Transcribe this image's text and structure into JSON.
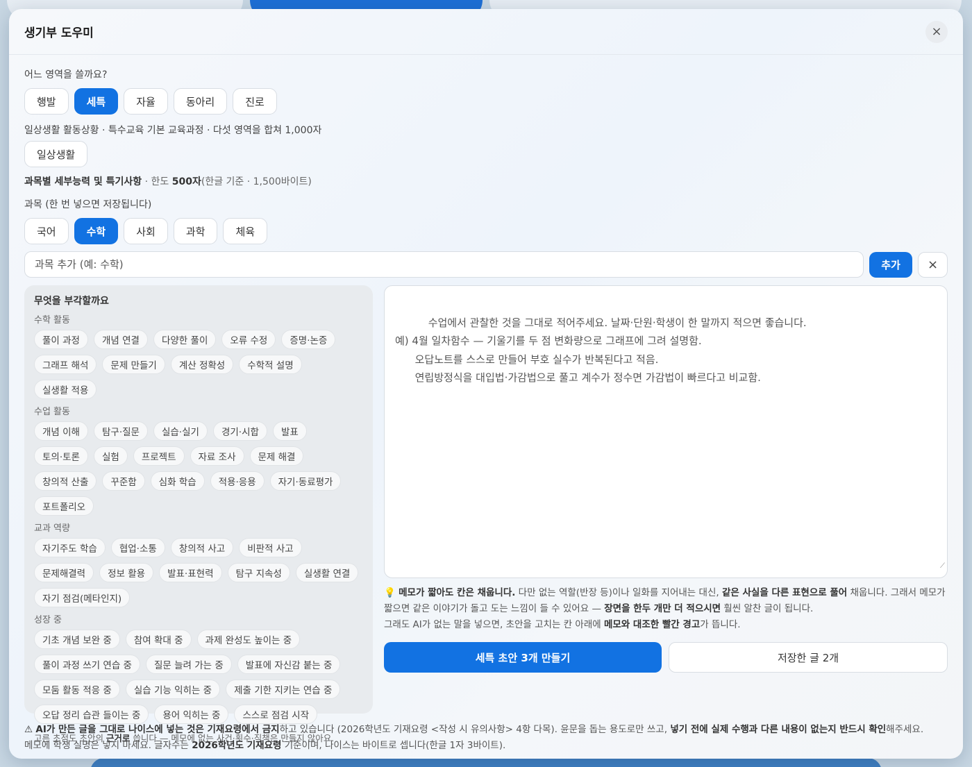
{
  "modal": {
    "title": "생기부 도우미",
    "close_icon": "×"
  },
  "area": {
    "label": "어느 영역을 쓸까요?",
    "tabs": [
      "행발",
      "세특",
      "자율",
      "동아리",
      "진로"
    ],
    "selected": "세특"
  },
  "daily": {
    "note": "일상생활 활동상황 · 특수교육 기본 교육과정 · 다섯 영역을 합쳐 1,000자",
    "button": "일상생활"
  },
  "limit": {
    "bold": "과목별 세부능력 및 특기사항",
    "middle": " · 한도 ",
    "bold2": "500자",
    "rest": "(한글 기준 · 1,500바이트)"
  },
  "subjects": {
    "label": "과목 (한 번 넣으면 저장됩니다)",
    "tabs": [
      "국어",
      "수학",
      "사회",
      "과학",
      "체육"
    ],
    "selected": "수학",
    "input_placeholder": "과목 추가 (예: 수학)",
    "add_label": "추가",
    "clear_icon": "×"
  },
  "panel": {
    "title": "무엇을 부각할까요",
    "groups": [
      {
        "label": "수학 활동",
        "chips": [
          "풀이 과정",
          "개념 연결",
          "다양한 풀이",
          "오류 수정",
          "증명·논증",
          "그래프 해석",
          "문제 만들기",
          "계산 정확성",
          "수학적 설명",
          "실생활 적용"
        ]
      },
      {
        "label": "수업 활동",
        "chips": [
          "개념 이해",
          "탐구·질문",
          "실습·실기",
          "경기·시합",
          "발표",
          "토의·토론",
          "실험",
          "프로젝트",
          "자료 조사",
          "문제 해결",
          "창의적 산출",
          "꾸준함",
          "심화 학습",
          "적용·응용",
          "자기·동료평가",
          "포트폴리오"
        ]
      },
      {
        "label": "교과 역량",
        "chips": [
          "자기주도 학습",
          "협업·소통",
          "창의적 사고",
          "비판적 사고",
          "문제해결력",
          "정보 활용",
          "발표·표현력",
          "탐구 지속성",
          "실생활 연결",
          "자기 점검(메타인지)"
        ]
      },
      {
        "label": "성장 중",
        "chips": [
          "기초 개념 보완 중",
          "참여 확대 중",
          "과제 완성도 높이는 중",
          "풀이 과정 쓰기 연습 중",
          "질문 늘려 가는 중",
          "발표에 자신감 붙는 중",
          "모둠 활동 적응 중",
          "실습 기능 익히는 중",
          "제출 기한 지키는 연습 중",
          "오답 정리 습관 들이는 중",
          "용어 익히는 중",
          "스스로 점검 시작"
        ]
      }
    ],
    "foot_pre": "고른 초점도 초안의 ",
    "foot_bold": "근거로",
    "foot_post": " 씁니다 — 메모에 없는 사건·횟수·직책은 만들지 않아요."
  },
  "memo": {
    "placeholder": "수업에서 관찰한 것을 그대로 적어주세요. 날짜·단원·학생이 한 말까지 적으면 좋습니다.\n예) 4월 일차함수 — 기울기를 두 점 변화량으로 그래프에 그려 설명함.\n      오답노트를 스스로 만들어 부호 실수가 반복된다고 적음.\n      연립방정식을 대입법·가감법으로 풀고 계수가 정수면 가감법이 빠르다고 비교함.",
    "resize_icon": "⟋"
  },
  "tip": {
    "icon": "💡",
    "b1": "메모가 짧아도 칸은 채웁니다.",
    "t1": " 다만 없는 역할(반장 등)이나 일화를 지어내는 대신, ",
    "b2": "같은 사실을 다른 표현으로 풀어",
    "t2": " 채웁니다. 그래서 메모가 짧으면 같은 이야기가 돌고 도는 느낌이 들 수 있어요 — ",
    "b3": "장면을 한두 개만 더 적으시면",
    "t3": " 훨씬 알찬 글이 됩니다.",
    "t4": "그래도 AI가 없는 말을 넣으면, 초안을 고치는 칸 아래에 ",
    "b4": "메모와 대조한 빨간 경고",
    "t5": "가 뜹니다."
  },
  "actions": {
    "make": "세특 초안 3개 만들기",
    "saved": "저장한 글 2개"
  },
  "warning": {
    "icon": "⚠",
    "b1": "AI가 만든 글을 그대로 나이스에 넣는 것은 기재요령에서 금지",
    "t1": "하고 있습니다 (2026학년도 기재요령 <작성 시 유의사항> 4항 다목). 윤문을 돕는 용도로만 쓰고, ",
    "b2": "넣기 전에 실제 수행과 다른 내용이 없는지 반드시 확인",
    "t2": "해주세요.",
    "t3": "메모에 학생 실명은 넣지 마세요. 글자수는 ",
    "b3": "2026학년도 기재요령",
    "t4": " 기준이며, 나이스는 바이트로 셉니다(한글 1자 3바이트)."
  }
}
